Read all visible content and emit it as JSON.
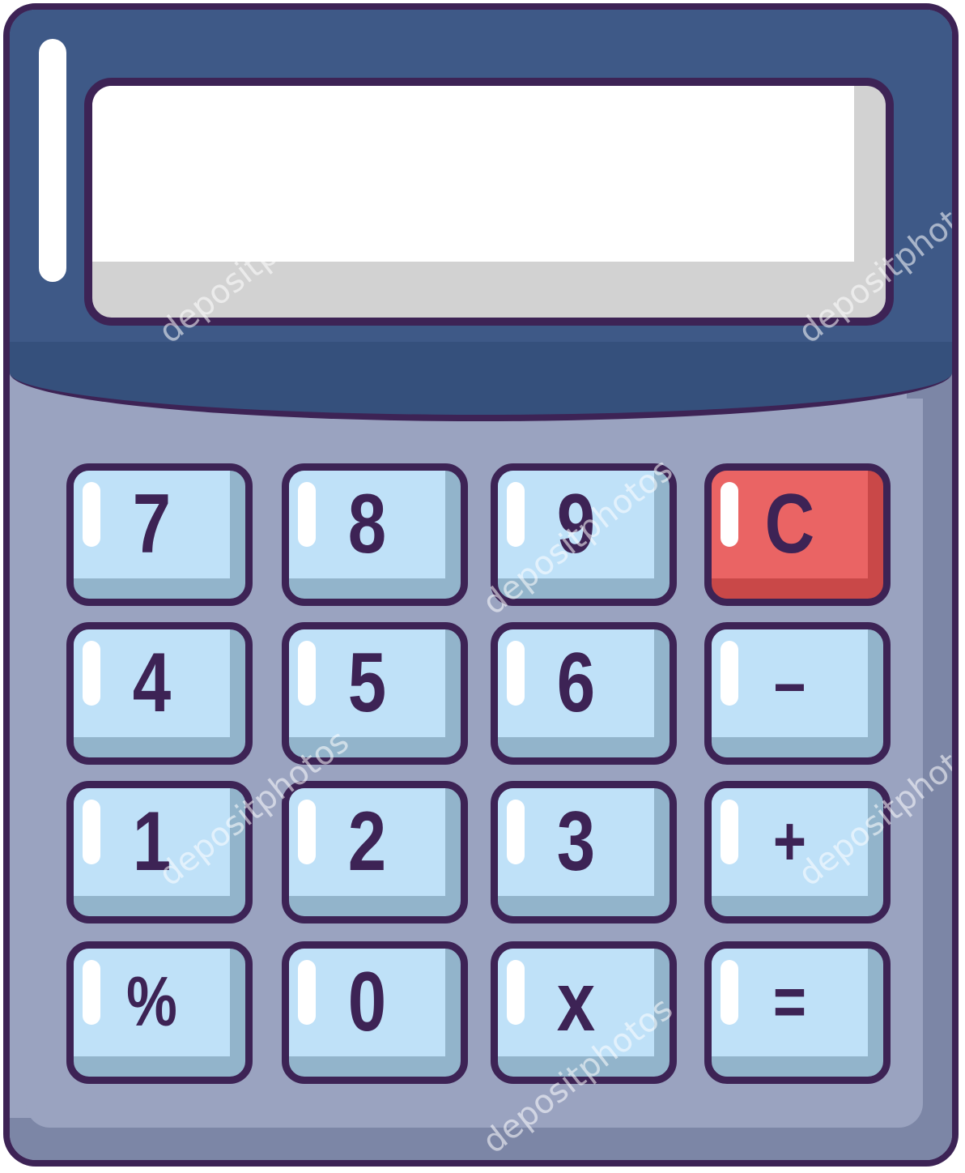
{
  "keys": [
    {
      "id": "7",
      "label": "7",
      "variant": "normal"
    },
    {
      "id": "8",
      "label": "8",
      "variant": "normal"
    },
    {
      "id": "9",
      "label": "9",
      "variant": "normal"
    },
    {
      "id": "clear",
      "label": "C",
      "variant": "red"
    },
    {
      "id": "4",
      "label": "4",
      "variant": "normal"
    },
    {
      "id": "5",
      "label": "5",
      "variant": "normal"
    },
    {
      "id": "6",
      "label": "6",
      "variant": "normal"
    },
    {
      "id": "minus",
      "label": "–",
      "variant": "normal"
    },
    {
      "id": "1",
      "label": "1",
      "variant": "normal"
    },
    {
      "id": "2",
      "label": "2",
      "variant": "normal"
    },
    {
      "id": "3",
      "label": "3",
      "variant": "normal"
    },
    {
      "id": "plus",
      "label": "+",
      "variant": "normal"
    },
    {
      "id": "percent",
      "label": "%",
      "variant": "normal"
    },
    {
      "id": "0",
      "label": "0",
      "variant": "normal"
    },
    {
      "id": "multiply",
      "label": "x",
      "variant": "normal"
    },
    {
      "id": "equals",
      "label": "=",
      "variant": "normal"
    }
  ],
  "display": {
    "value": ""
  },
  "watermark": "depositphotos",
  "colors": {
    "outline": "#3d2355",
    "body": "#9aa3c0",
    "top_band": "#3e5987",
    "key_face": "#bfe1f8",
    "key_side": "#92b4cb",
    "clear_key": "#ea6464"
  }
}
